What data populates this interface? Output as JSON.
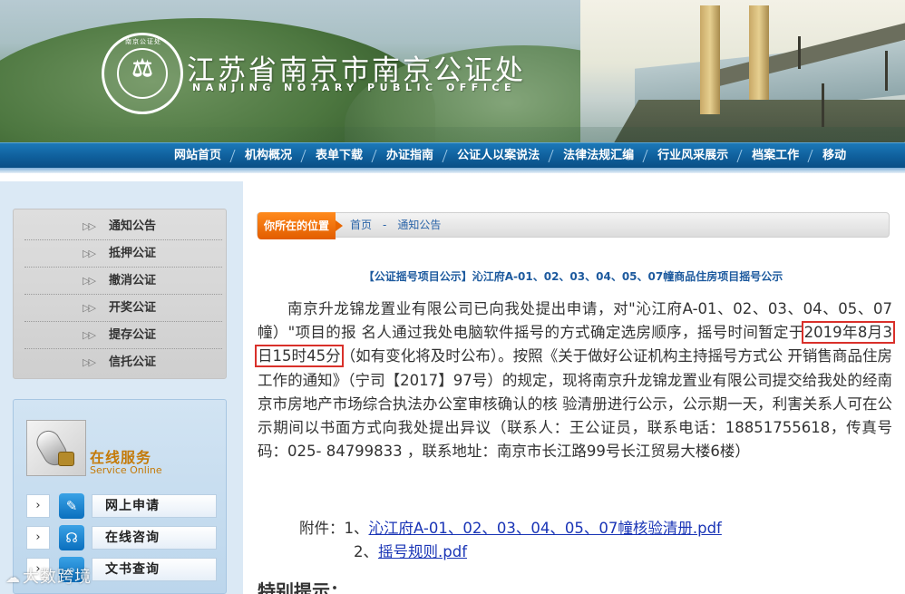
{
  "header": {
    "title": "江苏省南京市南京公证处",
    "subtitle": "NANJING NOTARY PUBLIC OFFICE",
    "logo_ring_text": "南京公证处",
    "logo_side_text": "NANJING NOTARY PUBLIC OFFICE"
  },
  "nav": {
    "items": [
      "网站首页",
      "机构概况",
      "表单下载",
      "办证指南",
      "公证人以案说法",
      "法律法规汇编",
      "行业风采展示",
      "档案工作",
      "移动"
    ]
  },
  "sidebar": {
    "menu": [
      "通知公告",
      "抵押公证",
      "撤消公证",
      "开奖公证",
      "提存公证",
      "信托公证"
    ],
    "arrow_glyph": "▷▷",
    "service": {
      "title": "在线服务",
      "subtitle": "Service Online",
      "items": [
        {
          "label": "网上申请",
          "icon": "edit-icon"
        },
        {
          "label": "在线咨询",
          "icon": "headset-icon"
        },
        {
          "label": "文书查询",
          "icon": "search-icon"
        }
      ],
      "chevron": "›"
    }
  },
  "watermark": "大数跨境",
  "breadcrumb": {
    "tag": "你所在的位置",
    "home": "首页",
    "separator": "-",
    "current": "通知公告"
  },
  "article": {
    "title": "【公证摇号项目公示】沁江府A-01、02、03、04、05、07幢商品住房项目摇号公示",
    "para_before": "南京升龙锦龙置业有限公司已向我处提出申请，对\"沁江府A-01、02、03、04、05、07幢）\"项目的报 名人通过我处电脑软件摇号的方式确定选房顺序，摇号时间暂定于",
    "highlight": "2019年8月3日15时45分",
    "para_after": "（如有变化将及时公布）。按照《关于做好公证机构主持摇号方式公 开销售商品住房工作的通知》（宁司【2017】97号）的规定，现将南京升龙锦龙置业有限公司提交给我处的经南京市房地产市场综合执法办公室审核确认的核 验清册进行公示，公示期一天，利害关系人可在公示期间以书面方式向我处提出异议（联系人：王公证员，联系电话：18851755618，传真号码：025- 84799833 ，联系地址：南京市长江路99号长江贸易大楼6楼）",
    "attach_label": "附件：",
    "attach1_num": "1、",
    "attach1": "沁江府A-01、02、03、04、05、07幢核验清册.pdf",
    "attach2_num": "2、",
    "attach2": "摇号规则.pdf",
    "special_heading": "特别提示："
  }
}
